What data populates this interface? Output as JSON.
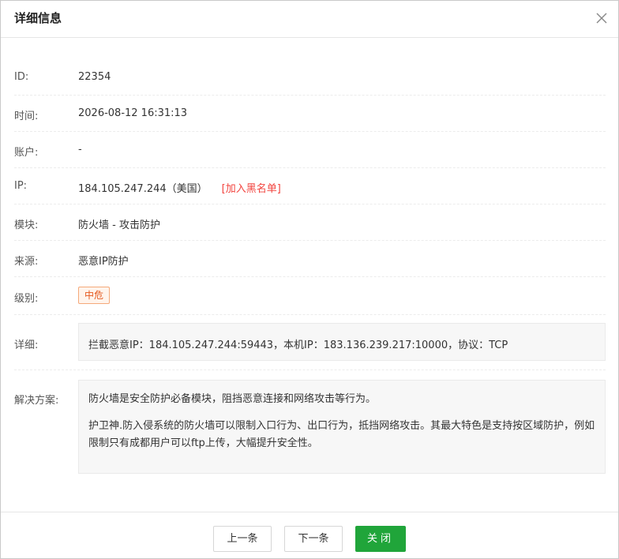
{
  "dialog": {
    "title": "详细信息",
    "close_icon": "close-icon"
  },
  "fields": {
    "id": {
      "label": "ID:",
      "value": "22354"
    },
    "time": {
      "label": "时间:",
      "value": "2026-08-12 16:31:13"
    },
    "account": {
      "label": "账户:",
      "value": "-"
    },
    "ip": {
      "label": "IP:",
      "value": "184.105.247.244（美国）",
      "action": "[加入黑名单]"
    },
    "module": {
      "label": "模块:",
      "value": "防火墙 - 攻击防护"
    },
    "source": {
      "label": "来源:",
      "value": "恶意IP防护"
    },
    "level": {
      "label": "级别:",
      "value": "中危",
      "color": "#e5581d"
    },
    "detail": {
      "label": "详细:",
      "value": "拦截恶意IP：184.105.247.244:59443，本机IP：183.136.239.217:10000，协议：TCP"
    },
    "solution": {
      "label": "解决方案:",
      "para1": "防火墙是安全防护必备模块，阻挡恶意连接和网络攻击等行为。",
      "para2": "护卫神.防入侵系统的防火墙可以限制入口行为、出口行为，抵挡网络攻击。其最大特色是支持按区域防护，例如限制只有成都用户可以ftp上传，大幅提升安全性。"
    }
  },
  "footer": {
    "prev_label": "上一条",
    "next_label": "下一条",
    "close_label": "关闭"
  },
  "colors": {
    "primary": "#20a53a",
    "danger_link": "#f2443f"
  }
}
